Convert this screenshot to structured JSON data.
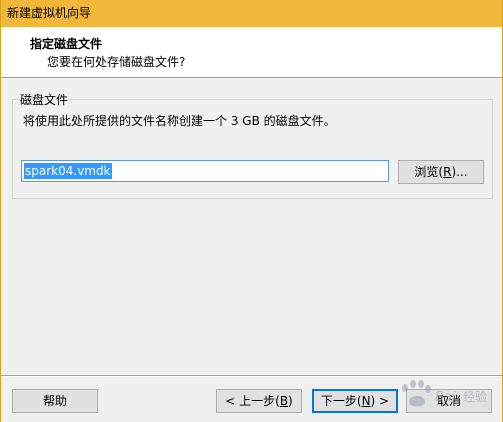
{
  "window": {
    "title": "新建虚拟机向导"
  },
  "header": {
    "title": "指定磁盘文件",
    "subtitle": "您要在何处存储磁盘文件?"
  },
  "disk_group": {
    "legend": "磁盘文件",
    "description": "将使用此处所提供的文件名称创建一个 3 GB 的磁盘文件。",
    "file_value": "spark04.vmdk",
    "browse_label_pre": "浏览(",
    "browse_label_key": "R",
    "browse_label_post": ")..."
  },
  "footer": {
    "help_label": "帮助",
    "back_label_pre": "< 上一步(",
    "back_label_key": "B",
    "back_label_post": ")",
    "next_label_pre": "下一步(",
    "next_label_key": "N",
    "next_label_post": ") >",
    "cancel_label": "取消"
  },
  "colors": {
    "titlebar": "#f1b73a",
    "accent": "#0078d7",
    "selection": "#3399ff"
  },
  "watermark": "Baidu 经验"
}
